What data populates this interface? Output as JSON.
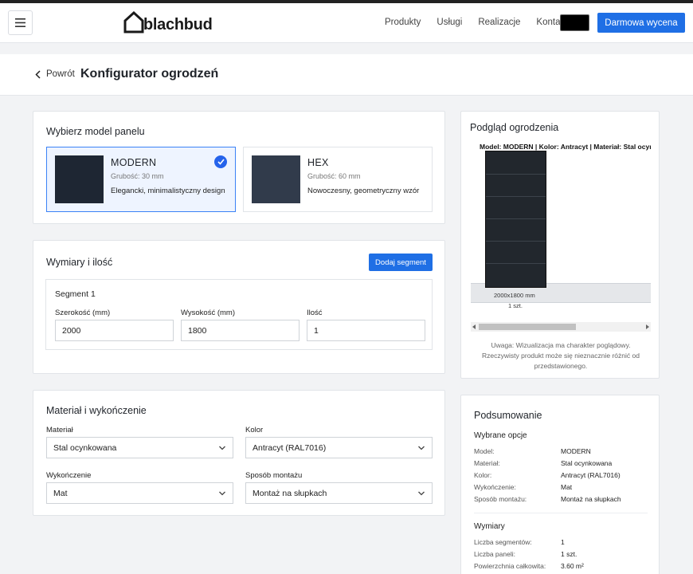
{
  "header": {
    "logo_text": "blachbud",
    "nav": [
      "Produkty",
      "Usługi",
      "Realizacje",
      "Kontakt"
    ],
    "cta_label": "Darmowa wycena"
  },
  "titlebar": {
    "back_label": "Powrót",
    "title": "Konfigurator ogrodzeń"
  },
  "panel_model": {
    "title": "Wybierz model panelu",
    "options": [
      {
        "name": "MODERN",
        "thickness": "Grubość: 30 mm",
        "description": "Elegancki, minimalistyczny design",
        "swatch_color": "#1e2633",
        "selected": true
      },
      {
        "name": "HEX",
        "thickness": "Grubość: 60 mm",
        "description": "Nowoczesny, geometryczny wzór",
        "swatch_color": "#313b4b",
        "selected": false
      }
    ]
  },
  "dimensions": {
    "title": "Wymiary i ilość",
    "add_segment_label": "Dodaj segment",
    "segment": {
      "title": "Segment 1",
      "width_label": "Szerokość (mm)",
      "width_value": "2000",
      "height_label": "Wysokość (mm)",
      "height_value": "1800",
      "qty_label": "Ilość",
      "qty_value": "1"
    }
  },
  "material": {
    "title": "Materiał i wykończenie",
    "material_label": "Materiał",
    "material_value": "Stal ocynkowana",
    "color_label": "Kolor",
    "color_value": "Antracyt (RAL7016)",
    "finish_label": "Wykończenie",
    "finish_value": "Mat",
    "mount_label": "Sposób montażu",
    "mount_value": "Montaż na słupkach"
  },
  "preview": {
    "title": "Podgląd ogrodzenia",
    "caption": "Model: MODERN | Kolor: Antracyt | Materiał: Stal ocynkowana",
    "dim_label": "2000x1800 mm",
    "qty_label": "1 szt.",
    "note": "Uwaga: Wizualizacja ma charakter poglądowy. Rzeczywisty produkt może się nieznacznie różnić od przedstawionego.",
    "fence_color": "#22272d"
  },
  "summary": {
    "title": "Podsumowanie",
    "options_heading": "Wybrane opcje",
    "options": [
      {
        "key": "Model:",
        "value": "MODERN"
      },
      {
        "key": "Materiał:",
        "value": "Stal ocynkowana"
      },
      {
        "key": "Kolor:",
        "value": "Antracyt (RAL7016)"
      },
      {
        "key": "Wykończenie:",
        "value": "Mat"
      },
      {
        "key": "Sposób montażu:",
        "value": "Montaż na słupkach"
      }
    ],
    "dims_heading": "Wymiary",
    "dims": [
      {
        "key": "Liczba segmentów:",
        "value": "1"
      },
      {
        "key": "Liczba paneli:",
        "value": "1 szt."
      },
      {
        "key": "Powierzchnia całkowita:",
        "value": "3.60 m²"
      }
    ]
  },
  "colors": {
    "accent": "#1f6fe5",
    "selected_bg": "#eef4ff"
  }
}
